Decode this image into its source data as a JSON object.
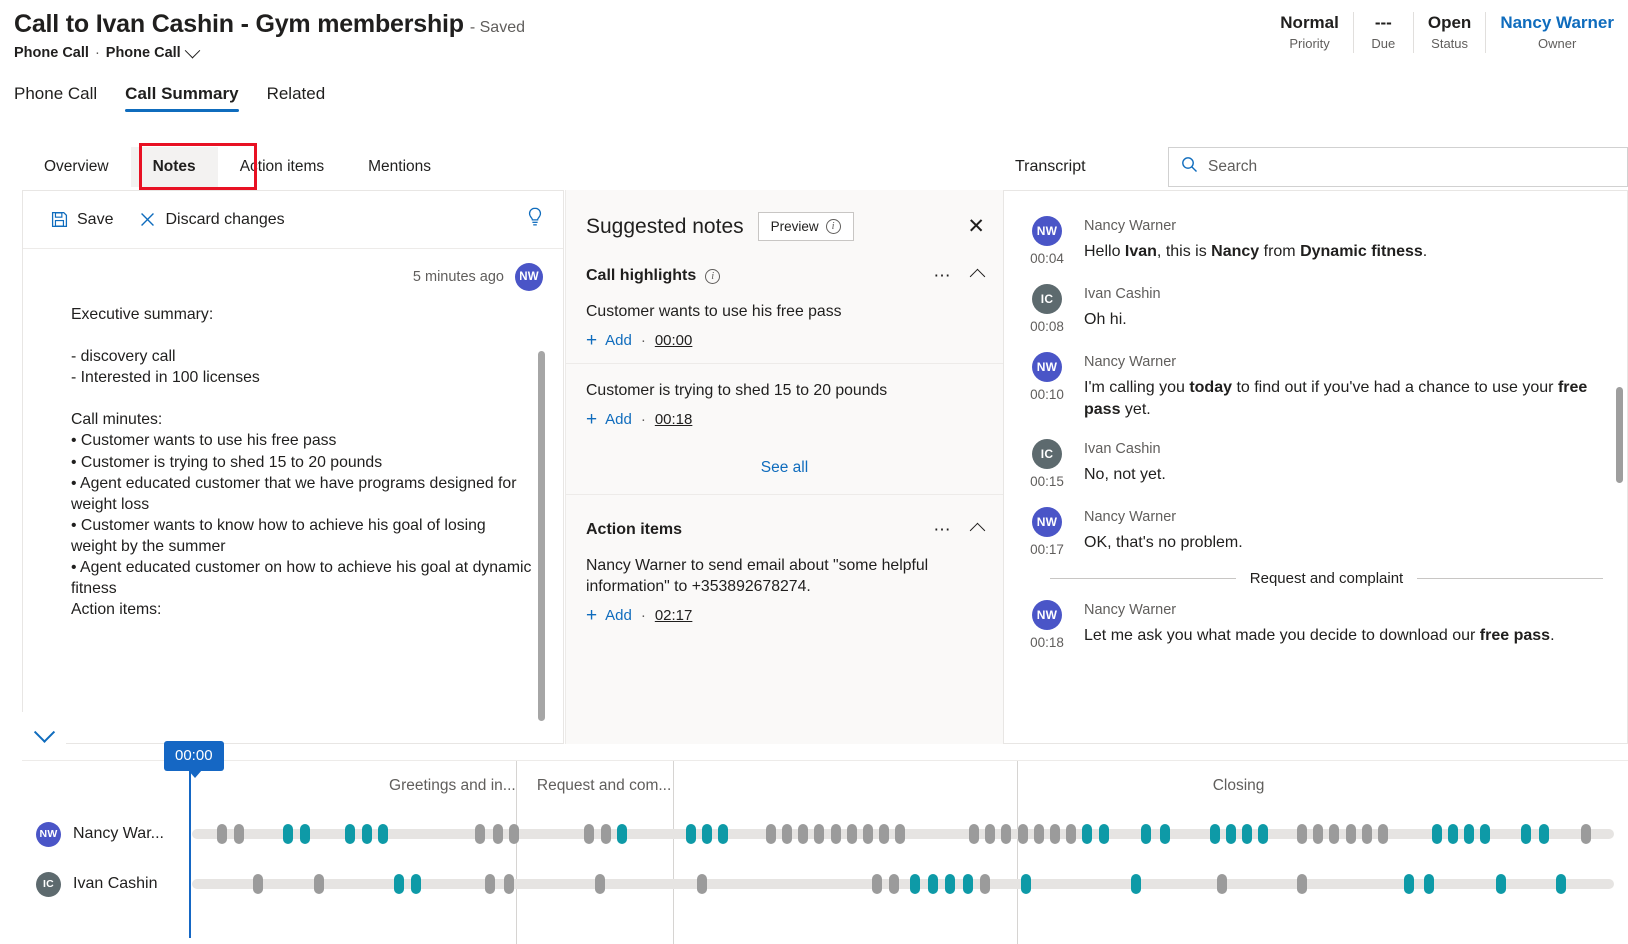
{
  "header": {
    "title": "Call to Ivan Cashin - Gym membership",
    "saved": "- Saved",
    "entity": "Phone Call",
    "form": "Phone Call",
    "dot": "·",
    "fields": [
      {
        "value": "Normal",
        "label": "Priority"
      },
      {
        "value": "---",
        "label": "Due"
      },
      {
        "value": "Open",
        "label": "Status"
      },
      {
        "value": "Nancy Warner",
        "label": "Owner"
      }
    ]
  },
  "main_tabs": [
    {
      "label": "Phone Call",
      "active": false
    },
    {
      "label": "Call Summary",
      "active": true
    },
    {
      "label": "Related",
      "active": false
    }
  ],
  "sub_tabs": [
    {
      "label": "Overview",
      "selected": false
    },
    {
      "label": "Notes",
      "selected": true,
      "highlighted": true
    },
    {
      "label": "Action items",
      "selected": false
    },
    {
      "label": "Mentions",
      "selected": false
    }
  ],
  "notes_editor": {
    "save_label": "Save",
    "discard_label": "Discard changes",
    "save_icon": "floppy-disk-icon",
    "discard_icon": "close-x-icon",
    "idea_icon": "lightbulb-icon",
    "timestamp": "5 minutes ago",
    "author_initials": "NW",
    "lines": [
      "Executive summary:",
      "- discovery call",
      "- Interested in 100 licenses",
      "Call minutes:",
      "• Customer wants to use his free pass",
      "• Customer is trying to shed 15 to 20 pounds",
      "• Agent educated customer that we have programs designed for weight loss",
      "• Customer wants to know how to achieve his goal of losing weight by the summer",
      "• Agent educated customer on how to achieve his goal at dynamic fitness",
      "Action items:"
    ]
  },
  "suggested_notes": {
    "title": "Suggested notes",
    "preview_label": "Preview",
    "close_icon": "close-x-icon",
    "see_all_label": "See all",
    "sections": [
      {
        "title": "Call highlights",
        "has_info_icon": true,
        "items": [
          {
            "text": "Customer wants to use his free pass",
            "add_label": "Add",
            "sep": "·",
            "time": "00:00"
          },
          {
            "text": "Customer is trying to shed 15 to 20 pounds",
            "add_label": "Add",
            "sep": "·",
            "time": "00:18"
          }
        ]
      },
      {
        "title": "Action items",
        "has_info_icon": false,
        "items": [
          {
            "text": "Nancy Warner to send email about \"some helpful information\" to +353892678274.",
            "add_label": "Add",
            "sep": "·",
            "time": "02:17"
          }
        ]
      }
    ]
  },
  "transcript": {
    "title": "Transcript",
    "search_placeholder": "Search",
    "search_value": "",
    "search_icon": "search-icon",
    "messages": [
      {
        "type": "msg",
        "speaker": "Nancy Warner",
        "initials": "NW",
        "time": "00:04",
        "parts": [
          {
            "t": "Hello ",
            "b": false
          },
          {
            "t": "Ivan",
            "b": true
          },
          {
            "t": ", this is ",
            "b": false
          },
          {
            "t": "Nancy",
            "b": true
          },
          {
            "t": " from ",
            "b": false
          },
          {
            "t": "Dynamic fitness",
            "b": true
          },
          {
            "t": ".",
            "b": false
          }
        ]
      },
      {
        "type": "msg",
        "speaker": "Ivan Cashin",
        "initials": "IC",
        "time": "00:08",
        "parts": [
          {
            "t": "Oh hi.",
            "b": false
          }
        ]
      },
      {
        "type": "msg",
        "speaker": "Nancy Warner",
        "initials": "NW",
        "time": "00:10",
        "parts": [
          {
            "t": "I'm calling you ",
            "b": false
          },
          {
            "t": "today",
            "b": true
          },
          {
            "t": " to find out if you've had a chance to use your ",
            "b": false
          },
          {
            "t": "free pass",
            "b": true
          },
          {
            "t": " yet.",
            "b": false
          }
        ]
      },
      {
        "type": "msg",
        "speaker": "Ivan Cashin",
        "initials": "IC",
        "time": "00:15",
        "parts": [
          {
            "t": "No, not yet.",
            "b": false
          }
        ]
      },
      {
        "type": "msg",
        "speaker": "Nancy Warner",
        "initials": "NW",
        "time": "00:17",
        "parts": [
          {
            "t": "OK, that's no problem.",
            "b": false
          }
        ]
      },
      {
        "type": "divider",
        "text": "Request and complaint"
      },
      {
        "type": "msg",
        "speaker": "Nancy Warner",
        "initials": "NW",
        "time": "00:18",
        "parts": [
          {
            "t": "Let me ask you what made you decide to download our ",
            "b": false
          },
          {
            "t": "free pass",
            "b": true
          },
          {
            "t": ".",
            "b": false
          }
        ]
      }
    ]
  },
  "timeline": {
    "collapse_icon": "chevron-down-icon",
    "cursor_time": "00:00",
    "topics": [
      {
        "label": "Greetings and in...",
        "x_pct": 13.0
      },
      {
        "label": "Request and com...",
        "x_pct": 23.5
      },
      {
        "label": "Closing",
        "x_pct": 71.5
      }
    ],
    "dividers_pct": [
      22.0,
      33.2,
      57.6
    ],
    "speakers": [
      {
        "name": "Nancy War...",
        "initials": "NW",
        "avatar": "nw",
        "marks": [
          {
            "p": 2.0,
            "c": "g"
          },
          {
            "p": 3.4,
            "c": "g"
          },
          {
            "p": 7.3,
            "c": "t"
          },
          {
            "p": 8.7,
            "c": "t"
          },
          {
            "p": 12.3,
            "c": "t"
          },
          {
            "p": 13.6,
            "c": "t"
          },
          {
            "p": 14.9,
            "c": "t"
          },
          {
            "p": 22.7,
            "c": "g"
          },
          {
            "p": 24.1,
            "c": "g"
          },
          {
            "p": 25.4,
            "c": "g"
          },
          {
            "p": 31.4,
            "c": "g"
          },
          {
            "p": 32.8,
            "c": "g"
          },
          {
            "p": 34.1,
            "c": "t"
          },
          {
            "p": 39.6,
            "c": "t"
          },
          {
            "p": 40.9,
            "c": "t"
          },
          {
            "p": 42.2,
            "c": "t"
          },
          {
            "p": 46.0,
            "c": "g"
          },
          {
            "p": 47.3,
            "c": "g"
          },
          {
            "p": 48.6,
            "c": "g"
          },
          {
            "p": 49.9,
            "c": "g"
          },
          {
            "p": 51.2,
            "c": "g"
          },
          {
            "p": 52.5,
            "c": "g"
          },
          {
            "p": 53.8,
            "c": "g"
          },
          {
            "p": 55.1,
            "c": "g"
          },
          {
            "p": 56.4,
            "c": "g"
          },
          {
            "p": 62.3,
            "c": "g"
          },
          {
            "p": 63.6,
            "c": "g"
          },
          {
            "p": 64.9,
            "c": "g"
          },
          {
            "p": 66.2,
            "c": "g"
          },
          {
            "p": 67.5,
            "c": "g"
          },
          {
            "p": 68.8,
            "c": "g"
          },
          {
            "p": 70.1,
            "c": "g"
          },
          {
            "p": 71.4,
            "c": "t"
          },
          {
            "p": 72.7,
            "c": "t"
          },
          {
            "p": 76.1,
            "c": "t"
          },
          {
            "p": 77.6,
            "c": "t"
          },
          {
            "p": 81.6,
            "c": "t"
          },
          {
            "p": 82.9,
            "c": "t"
          },
          {
            "p": 84.2,
            "c": "t"
          },
          {
            "p": 85.5,
            "c": "t"
          },
          {
            "p": 88.6,
            "c": "g"
          },
          {
            "p": 89.9,
            "c": "g"
          },
          {
            "p": 91.2,
            "c": "g"
          },
          {
            "p": 92.5,
            "c": "g"
          },
          {
            "p": 93.8,
            "c": "g"
          },
          {
            "p": 95.1,
            "c": "g"
          },
          {
            "p": 99.4,
            "c": "t"
          },
          {
            "p": 100.7,
            "c": "t"
          },
          {
            "p": 102.0,
            "c": "t"
          },
          {
            "p": 103.3,
            "c": "t"
          },
          {
            "p": 106.6,
            "c": "t"
          },
          {
            "p": 108.0,
            "c": "t"
          },
          {
            "p": 111.4,
            "c": "g"
          }
        ]
      },
      {
        "name": "Ivan Cashin",
        "initials": "IC",
        "avatar": "ic",
        "marks": [
          {
            "p": 4.9,
            "c": "g"
          },
          {
            "p": 9.8,
            "c": "g"
          },
          {
            "p": 16.2,
            "c": "t"
          },
          {
            "p": 17.6,
            "c": "t"
          },
          {
            "p": 23.5,
            "c": "g"
          },
          {
            "p": 25.0,
            "c": "g"
          },
          {
            "p": 32.3,
            "c": "g"
          },
          {
            "p": 40.5,
            "c": "g"
          },
          {
            "p": 54.5,
            "c": "g"
          },
          {
            "p": 55.9,
            "c": "g"
          },
          {
            "p": 57.6,
            "c": "t"
          },
          {
            "p": 59.0,
            "c": "t"
          },
          {
            "p": 60.4,
            "c": "t"
          },
          {
            "p": 61.8,
            "c": "t"
          },
          {
            "p": 63.2,
            "c": "g"
          },
          {
            "p": 66.5,
            "c": "t"
          },
          {
            "p": 75.3,
            "c": "t"
          },
          {
            "p": 82.2,
            "c": "g"
          },
          {
            "p": 88.6,
            "c": "g"
          },
          {
            "p": 97.2,
            "c": "t"
          },
          {
            "p": 98.8,
            "c": "t"
          },
          {
            "p": 104.6,
            "c": "t"
          },
          {
            "p": 109.4,
            "c": "t"
          }
        ]
      }
    ]
  }
}
